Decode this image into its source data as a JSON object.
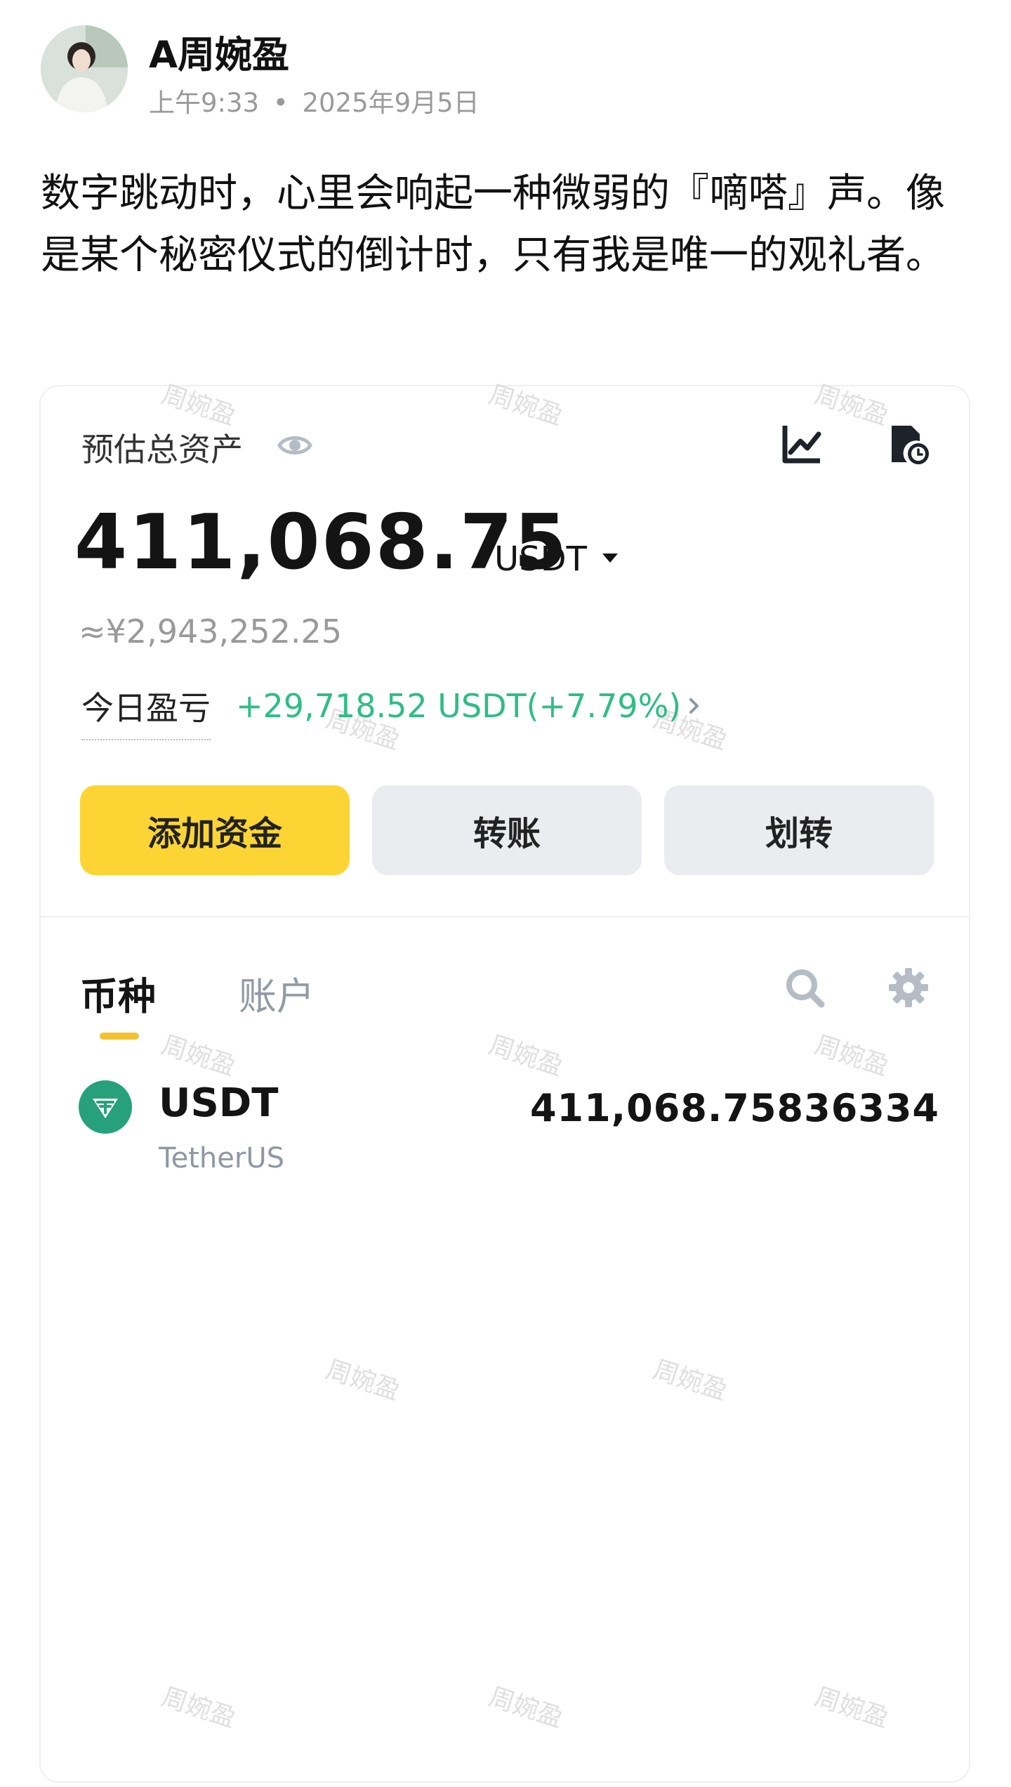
{
  "post": {
    "username": "A周婉盈",
    "time": "上午9:33",
    "separator": "•",
    "date": "2025年9月5日",
    "text": "数字跳动时，心里会响起一种微弱的『嘀嗒』声。像是某个秘密仪式的倒计时，只有我是唯一的观礼者。"
  },
  "wallet": {
    "assets_label": "预估总资产",
    "balance": "411,068.75",
    "unit": "USDT",
    "cny_equivalent": "≈¥2,943,252.25",
    "pnl_label": "今日盈亏",
    "pnl_value": "+29,718.52 USDT(+7.79%)",
    "buttons": {
      "add_funds": "添加资金",
      "transfer": "转账",
      "move": "划转"
    },
    "tabs": {
      "coins": "币种",
      "accounts": "账户"
    },
    "holdings": [
      {
        "symbol": "USDT",
        "name": "TetherUS",
        "amount": "411,068.75836334"
      }
    ]
  },
  "watermark": "周婉盈",
  "colors": {
    "accent_yellow": "#fcd535",
    "positive_green": "#2ebd85",
    "tether_green": "#26a17b",
    "secondary_button": "#eaecef"
  }
}
